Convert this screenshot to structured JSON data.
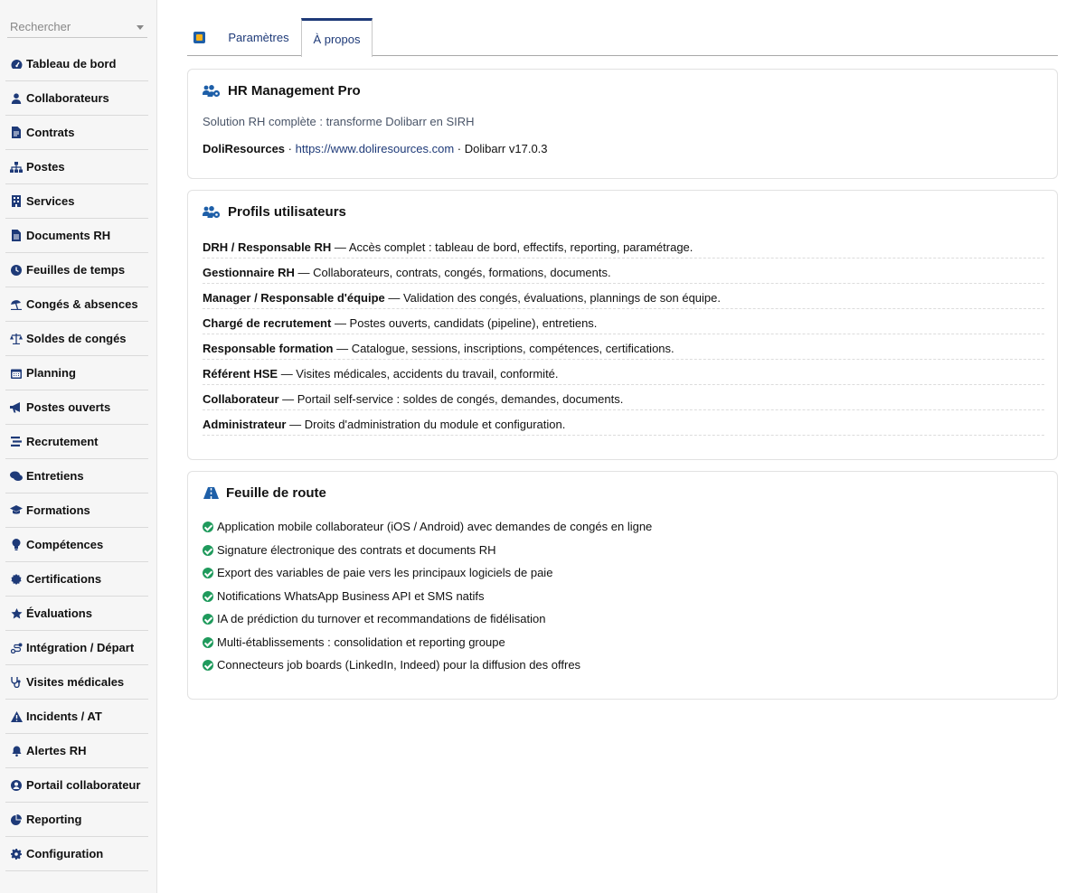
{
  "sidebar": {
    "search_placeholder": "Rechercher",
    "items": [
      {
        "label": "Tableau de bord",
        "icon": "dashboard-icon"
      },
      {
        "label": "Collaborateurs",
        "icon": "user-icon"
      },
      {
        "label": "Contrats",
        "icon": "contract-icon"
      },
      {
        "label": "Postes",
        "icon": "org-chart-icon"
      },
      {
        "label": "Services",
        "icon": "building-icon"
      },
      {
        "label": "Documents RH",
        "icon": "document-icon"
      },
      {
        "label": "Feuilles de temps",
        "icon": "clock-icon"
      },
      {
        "label": "Congés & absences",
        "icon": "umbrella-beach-icon"
      },
      {
        "label": "Soldes de congés",
        "icon": "balance-scale-icon"
      },
      {
        "label": "Planning",
        "icon": "calendar-icon"
      },
      {
        "label": "Postes ouverts",
        "icon": "bullhorn-icon"
      },
      {
        "label": "Recrutement",
        "icon": "stream-icon"
      },
      {
        "label": "Entretiens",
        "icon": "comments-icon"
      },
      {
        "label": "Formations",
        "icon": "graduation-cap-icon"
      },
      {
        "label": "Compétences",
        "icon": "lightbulb-icon"
      },
      {
        "label": "Certifications",
        "icon": "certificate-icon"
      },
      {
        "label": "Évaluations",
        "icon": "star-icon"
      },
      {
        "label": "Intégration / Départ",
        "icon": "route-icon"
      },
      {
        "label": "Visites médicales",
        "icon": "stethoscope-icon"
      },
      {
        "label": "Incidents / AT",
        "icon": "warning-icon"
      },
      {
        "label": "Alertes RH",
        "icon": "bell-icon"
      },
      {
        "label": "Portail collaborateur",
        "icon": "user-circle-icon"
      },
      {
        "label": "Reporting",
        "icon": "pie-chart-icon"
      },
      {
        "label": "Configuration",
        "icon": "gear-icon"
      }
    ]
  },
  "tabs": {
    "params": "Paramètres",
    "about": "À propos"
  },
  "about": {
    "title": "HR Management Pro",
    "subtitle": "Solution RH complète : transforme Dolibarr en SIRH",
    "vendor": "DoliResources",
    "sep1": " · ",
    "url": "https://www.doliresources.com",
    "sep2": " · ",
    "version": "Dolibarr v17.0.3"
  },
  "profiles": {
    "title": "Profils utilisateurs",
    "rows": [
      {
        "role": "DRH / Responsable RH",
        "desc": " — Accès complet : tableau de bord, effectifs, reporting, paramétrage."
      },
      {
        "role": "Gestionnaire RH",
        "desc": " — Collaborateurs, contrats, congés, formations, documents."
      },
      {
        "role": "Manager / Responsable d'équipe",
        "desc": " — Validation des congés, évaluations, plannings de son équipe."
      },
      {
        "role": "Chargé de recrutement",
        "desc": " — Postes ouverts, candidats (pipeline), entretiens."
      },
      {
        "role": "Responsable formation",
        "desc": " — Catalogue, sessions, inscriptions, compétences, certifications."
      },
      {
        "role": "Référent HSE",
        "desc": " — Visites médicales, accidents du travail, conformité."
      },
      {
        "role": "Collaborateur",
        "desc": " — Portail self-service : soldes de congés, demandes, documents."
      },
      {
        "role": "Administrateur",
        "desc": " — Droits d'administration du module et configuration."
      }
    ]
  },
  "roadmap": {
    "title": "Feuille de route",
    "items": [
      "Application mobile collaborateur (iOS / Android) avec demandes de congés en ligne",
      "Signature électronique des contrats et documents RH",
      "Export des variables de paie vers les principaux logiciels de paie",
      "Notifications WhatsApp Business API et SMS natifs",
      "IA de prédiction du turnover et recommandations de fidélisation",
      "Multi-établissements : consolidation et reporting groupe",
      "Connecteurs job boards (LinkedIn, Indeed) pour la diffusion des offres"
    ]
  },
  "colors": {
    "accent": "#1e3a78",
    "check": "#1f9a5c"
  }
}
